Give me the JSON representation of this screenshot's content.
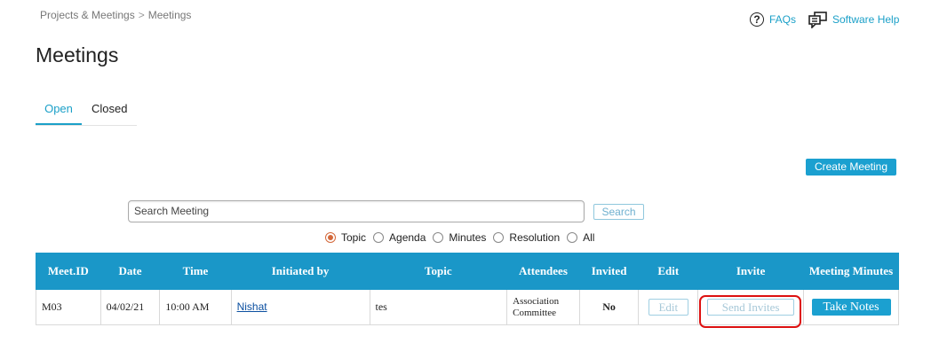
{
  "breadcrumb": {
    "parent": "Projects & Meetings",
    "separator": ">",
    "current": "Meetings"
  },
  "help_links": {
    "faqs": "FAQs",
    "software_help": "Software Help"
  },
  "page_title": "Meetings",
  "tabs": [
    {
      "label": "Open",
      "active": true
    },
    {
      "label": "Closed",
      "active": false
    }
  ],
  "create_button": "Create Meeting",
  "search": {
    "placeholder": "Search Meeting",
    "button": "Search"
  },
  "filters": [
    {
      "label": "Topic",
      "checked": true
    },
    {
      "label": "Agenda",
      "checked": false
    },
    {
      "label": "Minutes",
      "checked": false
    },
    {
      "label": "Resolution",
      "checked": false
    },
    {
      "label": "All",
      "checked": false
    }
  ],
  "table": {
    "headers": [
      "Meet.ID",
      "Date",
      "Time",
      "Initiated by",
      "Topic",
      "Attendees",
      "Invited",
      "Edit",
      "Invite",
      "Meeting Minutes"
    ],
    "rows": [
      {
        "id": "M03",
        "date": "04/02/21",
        "time": "10:00 AM",
        "initiated_by": "Nishat",
        "topic": "tes",
        "attendees": "Association Committee",
        "invited": "No",
        "edit": "Edit",
        "invite": "Send Invites",
        "minutes": "Take Notes"
      }
    ]
  },
  "colors": {
    "accent": "#1ba0d0",
    "header_bg": "#1a97c8",
    "alert": "#d01010"
  }
}
